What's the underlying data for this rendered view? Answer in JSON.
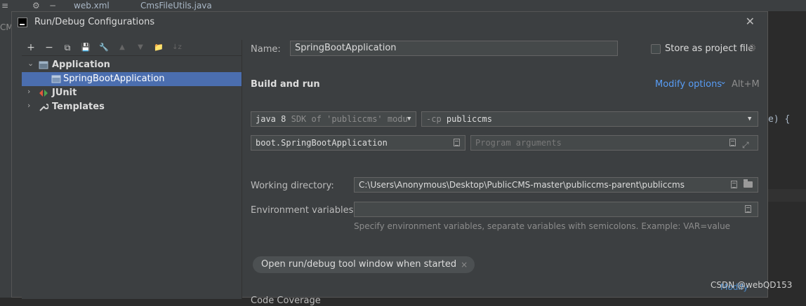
{
  "ide": {
    "tabs": [
      "web.xml",
      "CmsFileUtils.java"
    ],
    "left_text": "CM",
    "code_fragment": "e) {"
  },
  "watermark": "CSDN @webQD153",
  "dialog": {
    "title": "Run/Debug Configurations",
    "close_glyph": "✕",
    "toolbar": {
      "add": "+",
      "remove": "−",
      "copy": "⧉",
      "save": "💾",
      "edit_templates": "🔧",
      "move_up": "▲",
      "move_down": "▼",
      "new_folder": "📁",
      "sort": "↓z"
    },
    "tree": [
      {
        "label": "Application",
        "expanded": true,
        "icon": "application-icon"
      },
      {
        "label": "SpringBootApplication",
        "selected": true,
        "icon": "application-config-icon"
      },
      {
        "label": "JUnit",
        "expanded": false,
        "icon": "junit-icon"
      },
      {
        "label": "Templates",
        "expanded": false,
        "icon": "wrench-icon"
      }
    ],
    "form": {
      "name_label": "Name:",
      "name_value": "SpringBootApplication",
      "store_label": "Store as project file",
      "build_run_heading": "Build and run",
      "modify_options": "Modify options",
      "modify_options_arrow": "⌄",
      "modify_shortcut": "Alt+M",
      "sdk_java": "java 8",
      "sdk_detail": "SDK of 'publiccms' modu",
      "cp_flag": "-cp",
      "cp_value": "publiccms",
      "main_class": "boot.SpringBootApplication",
      "program_args_placeholder": "Program arguments",
      "working_dir_label": "Working directory:",
      "working_dir_value": "C:\\Users\\Anonymous\\Desktop\\PublicCMS-master\\publiccms-parent\\publiccms",
      "env_label": "Environment variables:",
      "env_value": "",
      "env_hint": "Specify environment variables, separate variables with semicolons. Example: VAR=value",
      "chip_label": "Open run/debug tool window when started",
      "chip_close": "×",
      "code_coverage": "Code Coverage",
      "coverage_modify": "Modify"
    }
  },
  "colors": {
    "accent": "#589df6",
    "selection": "#4b6eaf",
    "dialog_bg": "#3c3f41"
  }
}
